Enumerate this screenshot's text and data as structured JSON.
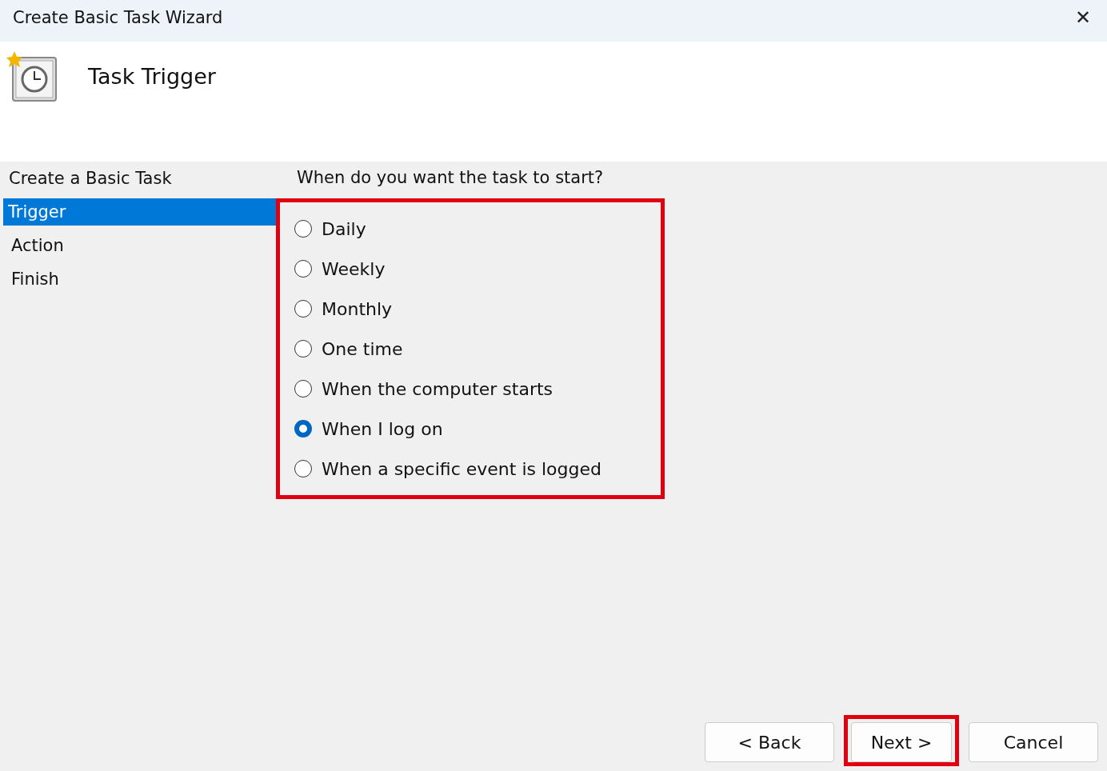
{
  "window": {
    "title": "Create Basic Task Wizard",
    "close": "✕"
  },
  "header": {
    "title": "Task Trigger"
  },
  "steps": [
    {
      "label": "Create a Basic Task",
      "selected": false
    },
    {
      "label": "Trigger",
      "selected": true
    },
    {
      "label": "Action",
      "selected": false
    },
    {
      "label": "Finish",
      "selected": false
    }
  ],
  "question": "When do you want the task to start?",
  "options_annotated": true,
  "options": [
    {
      "label": "Daily",
      "selected": false
    },
    {
      "label": "Weekly",
      "selected": false
    },
    {
      "label": "Monthly",
      "selected": false
    },
    {
      "label": "One time",
      "selected": false
    },
    {
      "label": "When the computer starts",
      "selected": false
    },
    {
      "label": "When I log on",
      "selected": true
    },
    {
      "label": "When a specific event is logged",
      "selected": false
    }
  ],
  "buttons": [
    {
      "label": "< Back",
      "annotated": false
    },
    {
      "label": "Next >",
      "annotated": true
    },
    {
      "label": "Cancel",
      "annotated": false
    }
  ]
}
